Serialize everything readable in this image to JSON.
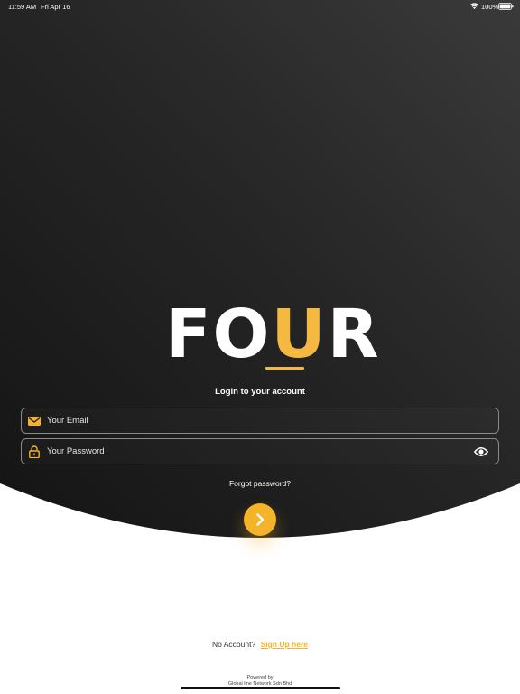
{
  "status_bar": {
    "time": "11:59 AM",
    "date": "Fri Apr 16",
    "battery": "100%"
  },
  "logo": {
    "part1": "FO",
    "accent": "U",
    "part2": "R"
  },
  "login": {
    "heading": "Login to your account",
    "email_placeholder": "Your Email",
    "password_placeholder": "Your Password",
    "forgot": "Forgot password?"
  },
  "signup": {
    "prompt": "No Account?",
    "link": "Sign Up here"
  },
  "footer": {
    "powered_by": "Powered by",
    "company": "Global line Network Sdn Bhd"
  },
  "colors": {
    "accent": "#f5b32a",
    "dark_bg": "#1e1e1e",
    "light_bg": "#ffffff"
  },
  "icons": {
    "email": "envelope-icon",
    "password": "lock-icon",
    "toggle": "eye-icon",
    "submit": "chevron-right-icon"
  }
}
